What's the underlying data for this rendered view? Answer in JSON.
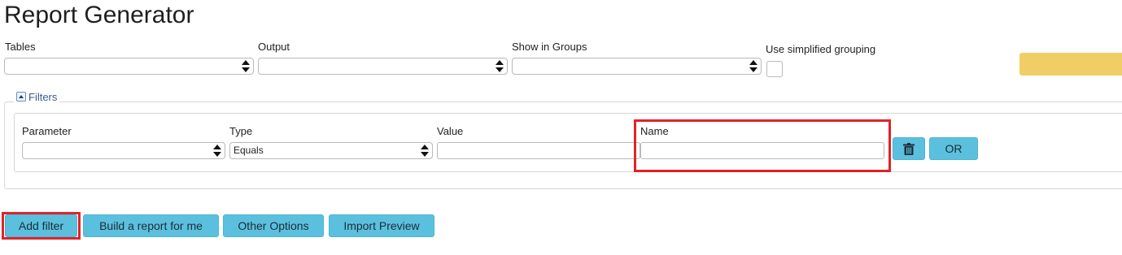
{
  "page": {
    "title": "Report Generator"
  },
  "top": {
    "tables_label": "Tables",
    "output_label": "Output",
    "groups_label": "Show in Groups",
    "simplified_label": "Use simplified grouping"
  },
  "filters": {
    "legend": "Filters",
    "parameter_label": "Parameter",
    "type_label": "Type",
    "type_value": "Equals",
    "value_label": "Value",
    "name_label": "Name",
    "or_button": "OR"
  },
  "actions": {
    "add_filter": "Add filter",
    "build_report": "Build a report for me",
    "other_options": "Other Options",
    "import_preview": "Import Preview"
  },
  "icons": {
    "collapse": "collapse-up-icon",
    "delete": "trash-icon"
  },
  "colors": {
    "button": "#5bc0de",
    "yellow": "#f1cd66",
    "highlight": "#e0232a"
  }
}
